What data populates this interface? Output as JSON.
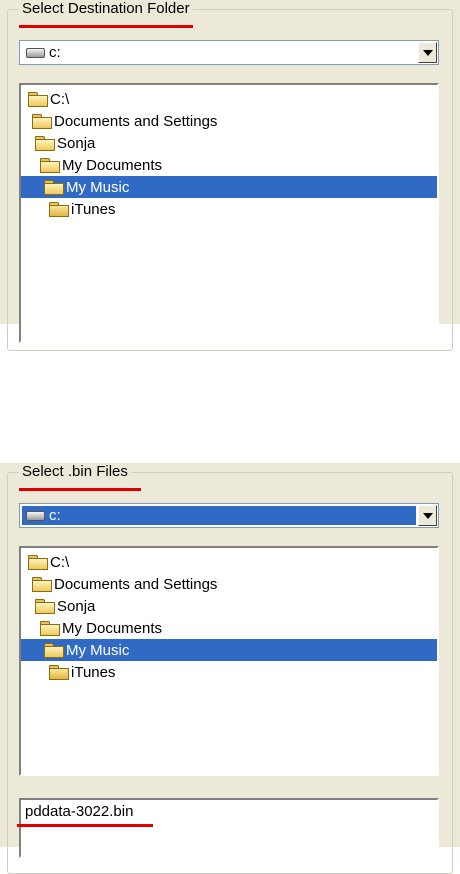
{
  "panel1": {
    "title": "Select Destination Folder",
    "drive": "c:",
    "tree": [
      "C:\\",
      "Documents and Settings",
      "Sonja",
      "My Documents",
      "My Music",
      "iTunes"
    ],
    "selected_item": "My Music"
  },
  "panel2": {
    "title": "Select .bin Files",
    "drive": "c:",
    "tree": [
      "C:\\",
      "Documents and Settings",
      "Sonja",
      "My Documents",
      "My Music",
      "iTunes"
    ],
    "selected_item": "My Music",
    "file_name": "pddata-3022.bin"
  },
  "colors": {
    "selection": "#316ac5",
    "annotation_underline": "#e00000",
    "dialog_background": "#ece9d8"
  },
  "icons": {
    "drive": "hard-drive-icon",
    "folder": "folder-icon",
    "dropdown": "chevron-down-icon"
  }
}
